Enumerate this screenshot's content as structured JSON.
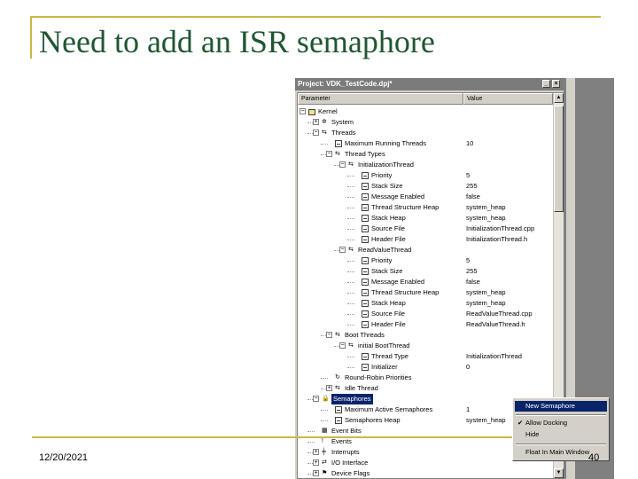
{
  "slide": {
    "title": "Need to add an ISR semaphore",
    "date": "12/20/2021",
    "page_number": "40"
  },
  "window": {
    "title": "Project: VDK_TestCode.dpj*",
    "columns": [
      "Parameter",
      "Value"
    ]
  },
  "tree": [
    {
      "label": "Kernel",
      "value": "",
      "level": 0,
      "expander": "-",
      "icon": "folder"
    },
    {
      "label": "System",
      "value": "",
      "level": 1,
      "expander": "+",
      "icon": "gear"
    },
    {
      "label": "Threads",
      "value": "",
      "level": 1,
      "expander": "-",
      "icon": "thread"
    },
    {
      "label": "Maximum Running Threads",
      "value": "10",
      "level": 2,
      "expander": "",
      "icon": "prop"
    },
    {
      "label": "Thread Types",
      "value": "",
      "level": 2,
      "expander": "-",
      "icon": "thread"
    },
    {
      "label": "InitializationThread",
      "value": "",
      "level": 3,
      "expander": "-",
      "icon": "thread"
    },
    {
      "label": "Priority",
      "value": "5",
      "level": 4,
      "expander": "",
      "icon": "prop"
    },
    {
      "label": "Stack Size",
      "value": "255",
      "level": 4,
      "expander": "",
      "icon": "prop"
    },
    {
      "label": "Message Enabled",
      "value": "false",
      "level": 4,
      "expander": "",
      "icon": "prop"
    },
    {
      "label": "Thread Structure Heap",
      "value": "system_heap",
      "level": 4,
      "expander": "",
      "icon": "prop"
    },
    {
      "label": "Stack Heap",
      "value": "system_heap",
      "level": 4,
      "expander": "",
      "icon": "prop"
    },
    {
      "label": "Source File",
      "value": "InitializationThread.cpp",
      "level": 4,
      "expander": "",
      "icon": "prop"
    },
    {
      "label": "Header File",
      "value": "InitializationThread.h",
      "level": 4,
      "expander": "",
      "icon": "prop"
    },
    {
      "label": "ReadValueThread",
      "value": "",
      "level": 3,
      "expander": "-",
      "icon": "thread"
    },
    {
      "label": "Priority",
      "value": "5",
      "level": 4,
      "expander": "",
      "icon": "prop"
    },
    {
      "label": "Stack Size",
      "value": "255",
      "level": 4,
      "expander": "",
      "icon": "prop"
    },
    {
      "label": "Message Enabled",
      "value": "false",
      "level": 4,
      "expander": "",
      "icon": "prop"
    },
    {
      "label": "Thread Structure Heap",
      "value": "system_heap",
      "level": 4,
      "expander": "",
      "icon": "prop"
    },
    {
      "label": "Stack Heap",
      "value": "system_heap",
      "level": 4,
      "expander": "",
      "icon": "prop"
    },
    {
      "label": "Source File",
      "value": "ReadValueThread.cpp",
      "level": 4,
      "expander": "",
      "icon": "prop"
    },
    {
      "label": "Header File",
      "value": "ReadValueThread.h",
      "level": 4,
      "expander": "",
      "icon": "prop"
    },
    {
      "label": "Boot Threads",
      "value": "",
      "level": 2,
      "expander": "-",
      "icon": "thread"
    },
    {
      "label": "initial BootThread",
      "value": "",
      "level": 3,
      "expander": "-",
      "icon": "thread"
    },
    {
      "label": "Thread Type",
      "value": "InitializationThread",
      "level": 4,
      "expander": "",
      "icon": "prop"
    },
    {
      "label": "Initializer",
      "value": "0",
      "level": 4,
      "expander": "",
      "icon": "prop"
    },
    {
      "label": "Round-Robin Priorities",
      "value": "",
      "level": 2,
      "expander": "",
      "icon": "rr"
    },
    {
      "label": "Idle Thread",
      "value": "",
      "level": 2,
      "expander": "+",
      "icon": "thread"
    },
    {
      "label": "Semaphores",
      "value": "",
      "level": 1,
      "expander": "-",
      "icon": "lock",
      "selected": true
    },
    {
      "label": "Maximum Active Semaphores",
      "value": "1",
      "level": 2,
      "expander": "",
      "icon": "prop"
    },
    {
      "label": "Semaphores Heap",
      "value": "system_heap",
      "level": 2,
      "expander": "",
      "icon": "prop"
    },
    {
      "label": "Event Bits",
      "value": "",
      "level": 1,
      "expander": "",
      "icon": "bits"
    },
    {
      "label": "Events",
      "value": "",
      "level": 1,
      "expander": "",
      "icon": "events"
    },
    {
      "label": "Interrupts",
      "value": "",
      "level": 1,
      "expander": "+",
      "icon": "interrupt"
    },
    {
      "label": "I/O Interface",
      "value": "",
      "level": 1,
      "expander": "+",
      "icon": "io"
    },
    {
      "label": "Device Flags",
      "value": "",
      "level": 1,
      "expander": "+",
      "icon": "flag"
    }
  ],
  "context_menu": {
    "items": [
      {
        "label": "New Semaphore",
        "highlighted": true
      },
      {
        "label": "Allow Docking",
        "checked": true
      },
      {
        "label": "Hide"
      },
      {
        "label": "Float In Main Window"
      }
    ]
  },
  "colors": {
    "title": "#1f5631",
    "accent_rule": "#c8b845",
    "selection": "#0a246a"
  }
}
